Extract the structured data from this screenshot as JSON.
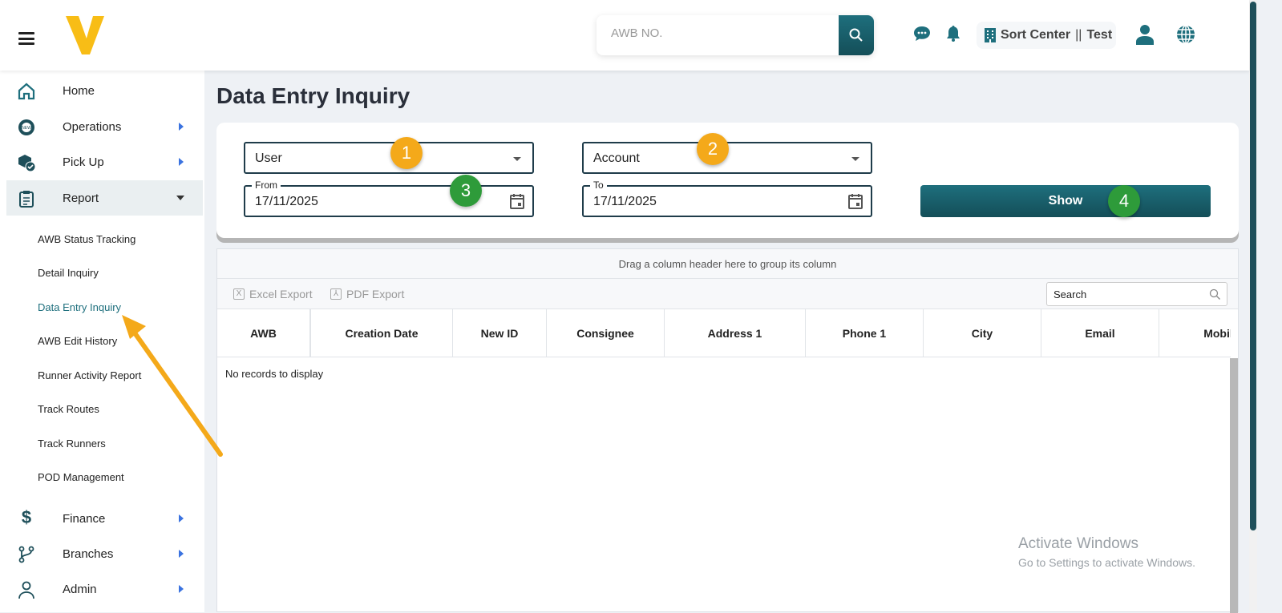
{
  "header": {
    "search_placeholder": "AWB NO.",
    "center_label": "Sort Center",
    "center_sep": "||",
    "center_name": "Test"
  },
  "sidebar": {
    "items": [
      {
        "label": "Home"
      },
      {
        "label": "Operations"
      },
      {
        "label": "Pick Up"
      },
      {
        "label": "Report"
      },
      {
        "label": "Finance"
      },
      {
        "label": "Branches"
      },
      {
        "label": "Admin"
      }
    ],
    "report_sub": [
      "AWB Status Tracking",
      "Detail Inquiry",
      "Data Entry Inquiry",
      "AWB Edit History",
      "Runner Activity Report",
      "Track Routes",
      "Track Runners",
      "POD Management"
    ]
  },
  "page": {
    "title": "Data Entry Inquiry"
  },
  "filters": {
    "user": "User",
    "account": "Account",
    "from_label": "From",
    "from_value": "17/11/2025",
    "to_label": "To",
    "to_value": "17/11/2025",
    "show": "Show"
  },
  "grid": {
    "group_hint": "Drag a column header here to group its column",
    "excel": "Excel Export",
    "pdf": "PDF Export",
    "search_placeholder": "Search",
    "columns": [
      "AWB",
      "Creation Date",
      "New ID",
      "Consignee",
      "Address 1",
      "Phone 1",
      "City",
      "Email",
      "Mobil"
    ],
    "empty": "No records to display"
  },
  "annotations": [
    "1",
    "2",
    "3",
    "4"
  ],
  "watermark": {
    "title": "Activate Windows",
    "sub": "Go to Settings to activate Windows."
  },
  "colors": {
    "primary": "#1e6f7d",
    "logo": "#f8bd16",
    "annotation_orange": "#f4a91a",
    "annotation_green": "#2e9b3a"
  }
}
